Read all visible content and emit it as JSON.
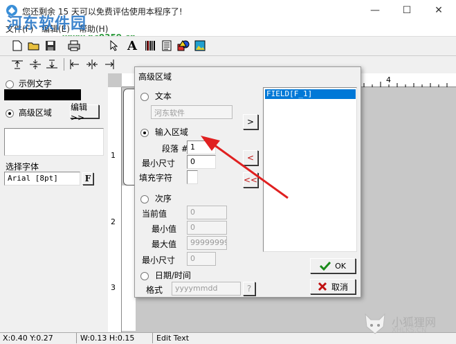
{
  "window": {
    "title": "您还剩余 15 天可以免费评估使用本程序了!",
    "minimize_glyph": "—",
    "maximize_glyph": "☐",
    "close_glyph": "✕"
  },
  "watermark": {
    "text": "河东软件园",
    "url": "www.pc0359.cn"
  },
  "menu": {
    "items": [
      "文件(F)",
      "编辑(E)",
      "帮助(H)"
    ]
  },
  "toolbar": {
    "icons": [
      "new-file-icon",
      "open-folder-icon",
      "save-icon",
      "print-icon",
      "select-arrow-icon",
      "text-icon",
      "barcode-icon",
      "document-icon",
      "shapes-icon",
      "image-icon"
    ],
    "text_glyph": "A"
  },
  "align_toolbar": {
    "icons": [
      "align-top-icon",
      "align-vcenter-icon",
      "align-bottom-icon",
      "align-left-icon",
      "align-hcenter-icon",
      "align-right-icon"
    ]
  },
  "left_panel": {
    "sample_text_label": "示例文字",
    "advanced_region_label": "高级区域",
    "edit_button": "编辑>>",
    "font_label": "选择字体",
    "font_value": "Arial [8pt]",
    "font_button": "F"
  },
  "ruler": {
    "top_mark": "4",
    "left_marks": [
      "1",
      "2",
      "3"
    ]
  },
  "status_bar": {
    "pos": "X:0.40  Y:0.27",
    "size": "W:0.13  H:0.15",
    "mode": "Edit Text"
  },
  "dialog": {
    "title": "高级区域",
    "text_radio": "文本",
    "text_value": "河东软件",
    "input_region_radio": "输入区域",
    "paragraph_label": "段落 #",
    "paragraph_value": "1",
    "min_size_label": "最小尺寸",
    "min_size_value": "0",
    "fill_char_label": "填充字符",
    "fill_char_value": "",
    "sequence_radio": "次序",
    "current_label": "当前值",
    "current_value": "0",
    "min_value_label": "最小值",
    "min_value": "0",
    "max_value_label": "最大值",
    "max_value": "999999999",
    "seq_min_size_label": "最小尺寸",
    "seq_min_size_value": "0",
    "datetime_radio": "日期/时间",
    "format_label": "格式",
    "format_value": "yyyymmdd",
    "format_help": "?",
    "add_button": ">",
    "remove_button": "<",
    "remove_all_button": "<<",
    "field_list": [
      "FIELD[F_1]"
    ],
    "ok_button": "OK",
    "cancel_button": "取消"
  },
  "corner_watermark": {
    "text": "小狐狸网",
    "url": "XHLKS.CN"
  },
  "colors": {
    "arrow": "#e02020",
    "selection": "#0078d7",
    "ok_check": "#1a8a1a",
    "cancel_x": "#c01010"
  }
}
